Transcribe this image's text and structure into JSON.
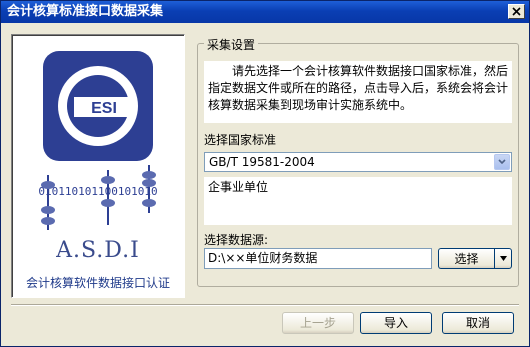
{
  "window": {
    "title": "会计核算标准接口数据采集"
  },
  "logo": {
    "badge_text": "ESI",
    "binary_text": "010110101100101010",
    "asdi_text": "A.S.D.I",
    "caption": "会计核算软件数据接口认证",
    "brand_color": "#1f3a8a"
  },
  "group": {
    "title": "采集设置",
    "instructions": "请先选择一个会计核算软件数据接口国家标准，然后指定数据文件或所在的路径，点击导入后，系统会将会计核算数据采集到现场审计实施系统中。"
  },
  "standard": {
    "label": "选择国家标准",
    "selected": "GB/T 19581-2004",
    "description": "企事业单位"
  },
  "source": {
    "label": "选择数据源:",
    "value": "D:\\××单位财务数据",
    "browse_label": "选择"
  },
  "buttons": {
    "prev": "上一步",
    "import": "导入",
    "cancel": "取消"
  }
}
